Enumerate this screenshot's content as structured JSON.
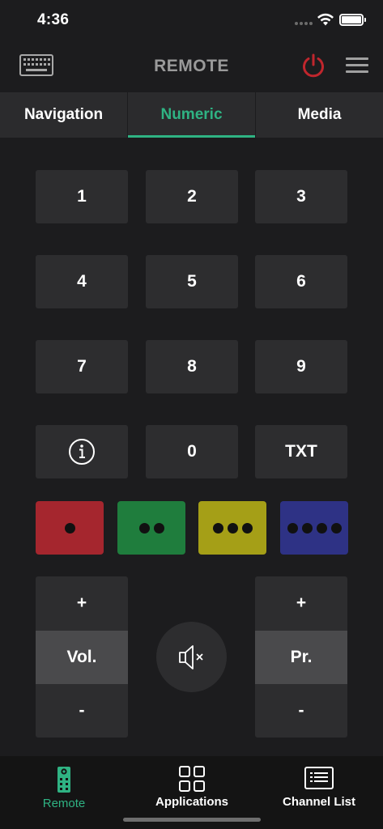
{
  "status_bar": {
    "time": "4:36"
  },
  "header": {
    "title": "REMOTE",
    "power_color": "#c0262d"
  },
  "tabs": [
    {
      "label": "Navigation",
      "active": false
    },
    {
      "label": "Numeric",
      "active": true
    },
    {
      "label": "Media",
      "active": false
    }
  ],
  "keypad": {
    "keys": [
      "1",
      "2",
      "3",
      "4",
      "5",
      "6",
      "7",
      "8",
      "9"
    ],
    "zero": "0",
    "txt": "TXT",
    "info_icon": "info-icon"
  },
  "color_keys": [
    {
      "name": "red",
      "color": "#a5262e",
      "dots": 1
    },
    {
      "name": "green",
      "color": "#1f7d3d",
      "dots": 2
    },
    {
      "name": "yellow",
      "color": "#a59f17",
      "dots": 3
    },
    {
      "name": "blue",
      "color": "#2e3285",
      "dots": 4
    }
  ],
  "volume": {
    "plus": "+",
    "label": "Vol.",
    "minus": "-"
  },
  "program": {
    "plus": "+",
    "label": "Pr.",
    "minus": "-"
  },
  "mute_icon": "mute-speaker-icon",
  "bottom_nav": [
    {
      "label": "Remote",
      "icon": "remote-icon",
      "active": true
    },
    {
      "label": "Applications",
      "icon": "apps-grid-icon",
      "active": false
    },
    {
      "label": "Channel List",
      "icon": "channel-list-icon",
      "active": false
    }
  ],
  "accent_color": "#2fb383"
}
